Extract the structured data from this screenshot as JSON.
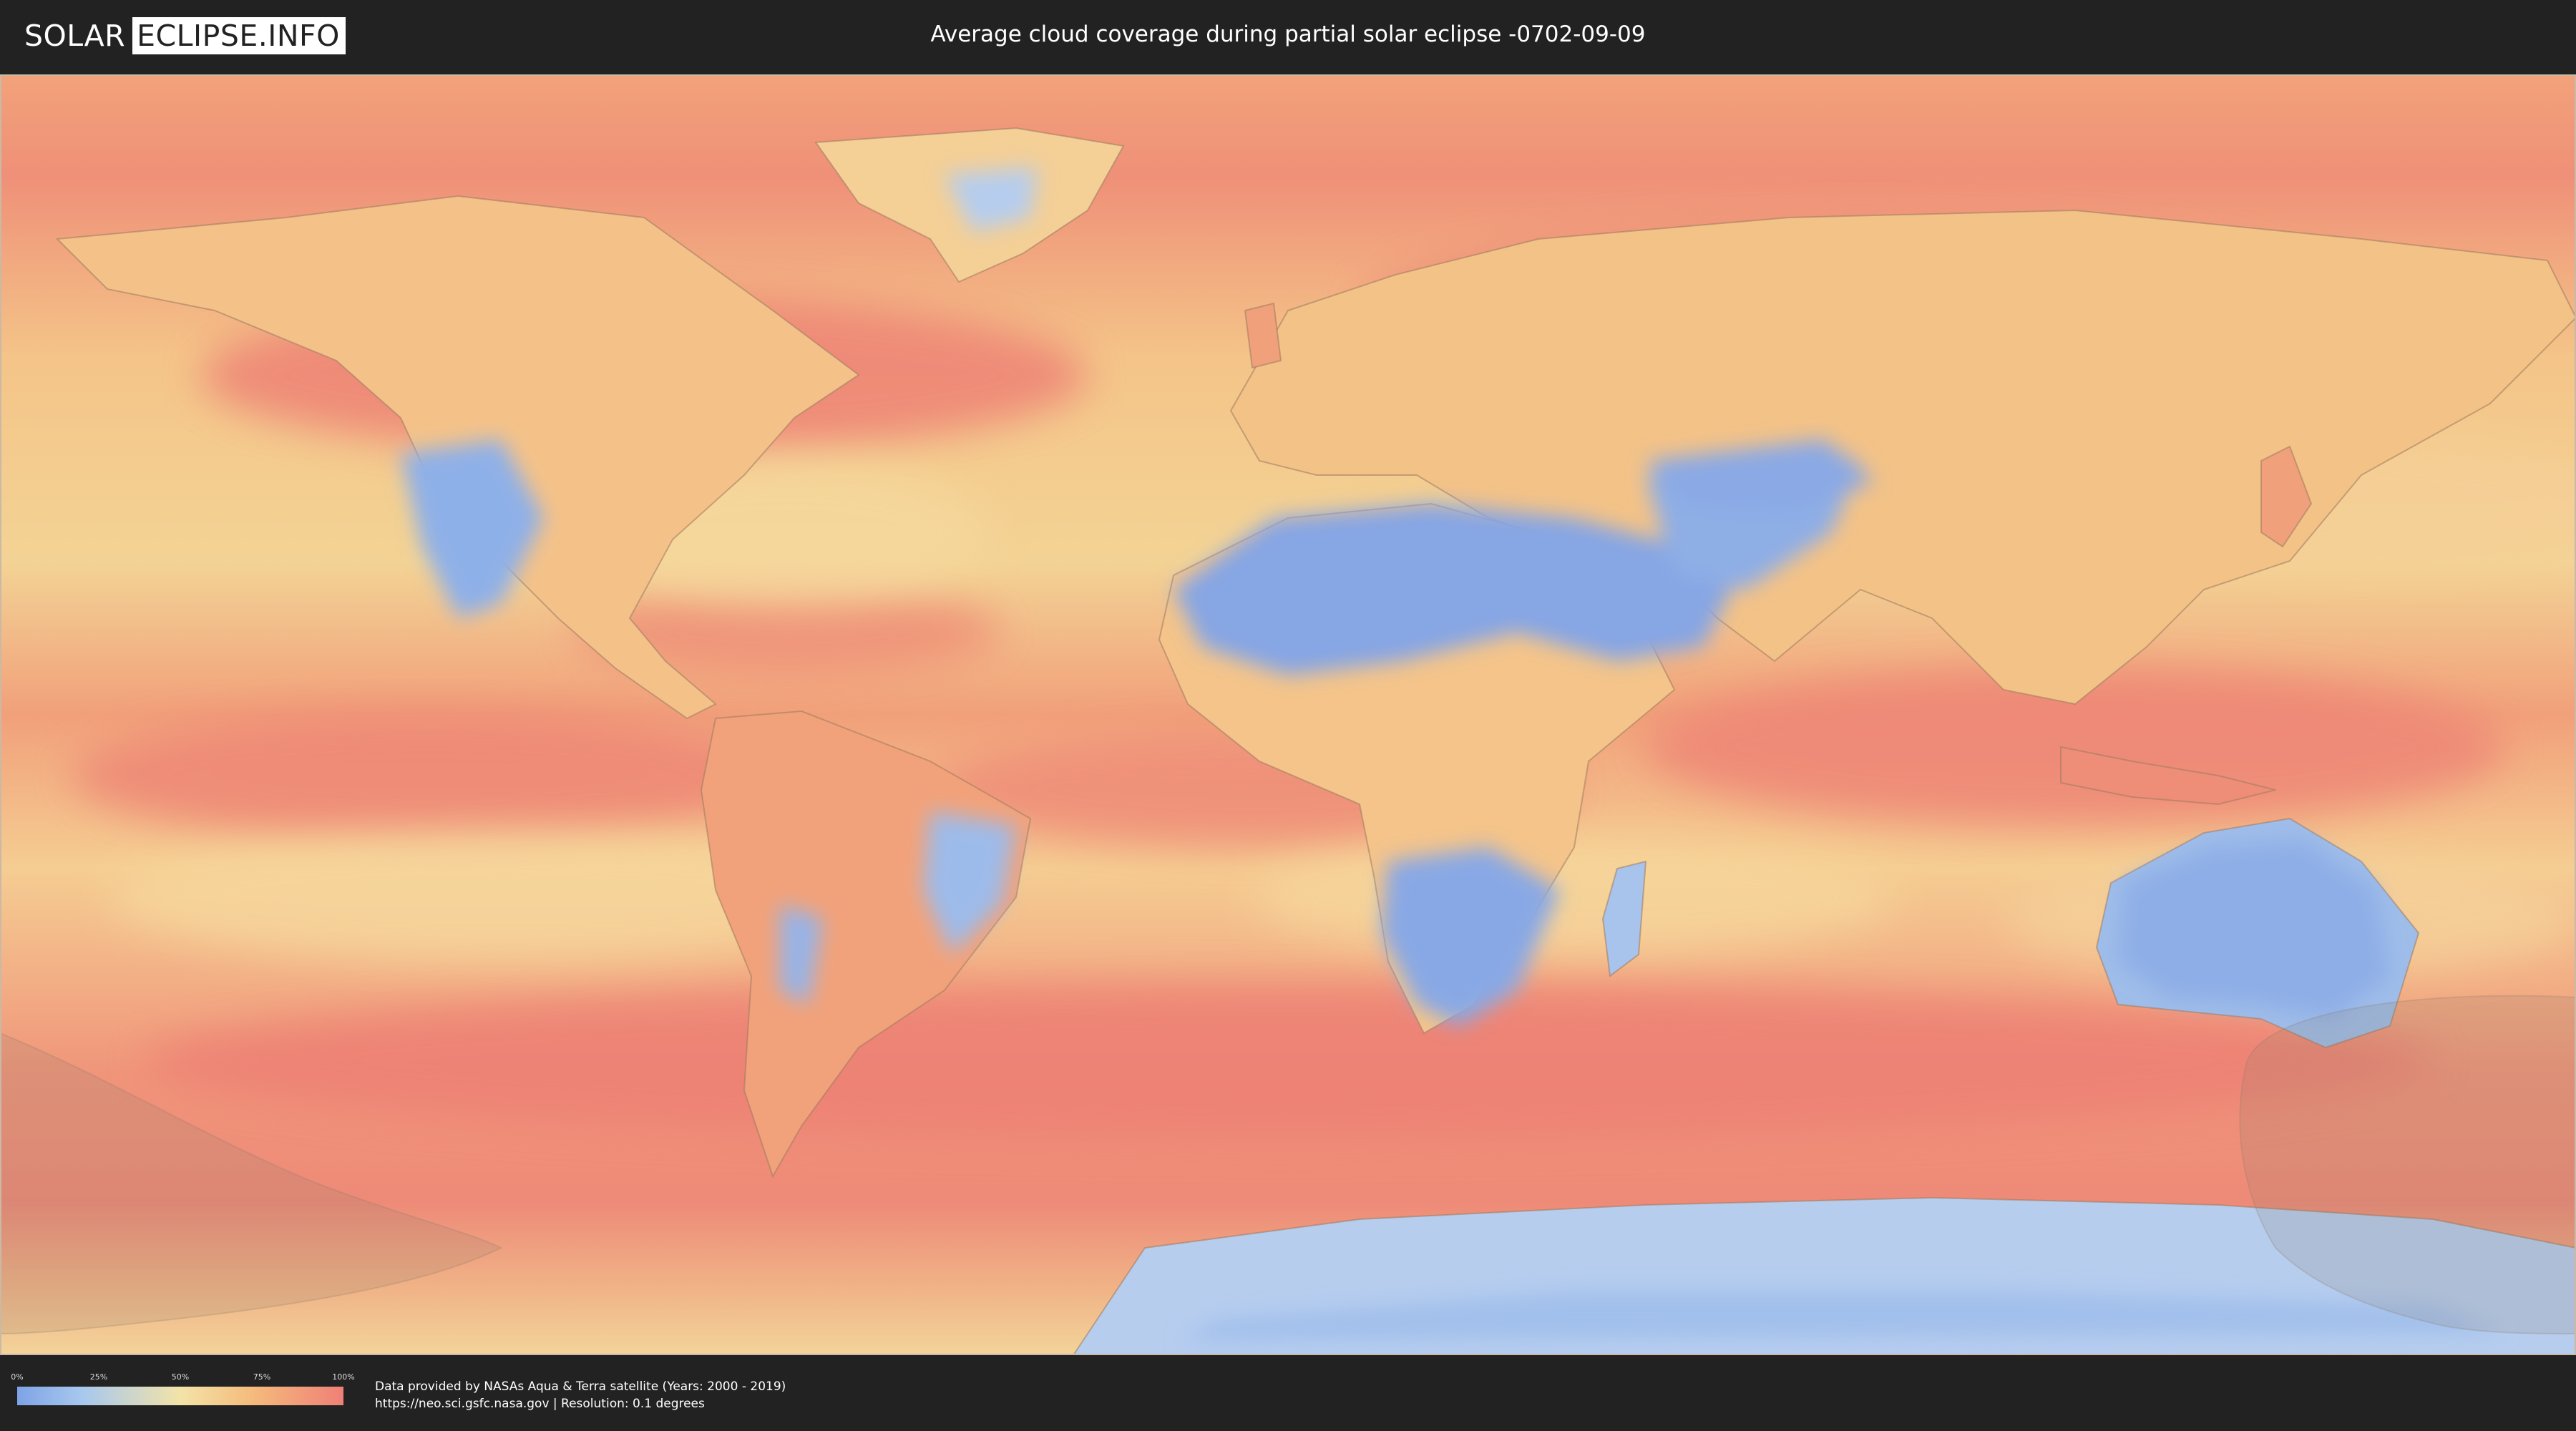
{
  "header": {
    "logo_left": "SOLAR",
    "logo_right": "ECLIPSE.INFO",
    "title": "Average cloud coverage during partial solar eclipse -0702-09-09"
  },
  "legend": {
    "ticks": [
      "0%",
      "25%",
      "50%",
      "75%",
      "100%"
    ],
    "tick_values": [
      0,
      25,
      50,
      75,
      100
    ],
    "colors": [
      "#7ea3e6",
      "#a8c8ee",
      "#f3e3a8",
      "#f5bb7c",
      "#ef8077"
    ]
  },
  "footer": {
    "credit_line1": "Data provided by NASAs Aqua & Terra satellite (Years: 2000 - 2019)",
    "credit_line2": "https://neo.sci.gsfc.nasa.gov | Resolution: 0.1 degrees"
  },
  "map": {
    "projection": "equirectangular",
    "cloud_low_color": "#7ea3e6",
    "cloud_mid_color": "#f3e3a8",
    "cloud_high_color": "#ef8077",
    "eclipse_shadow_color": "#8a7a6a"
  }
}
